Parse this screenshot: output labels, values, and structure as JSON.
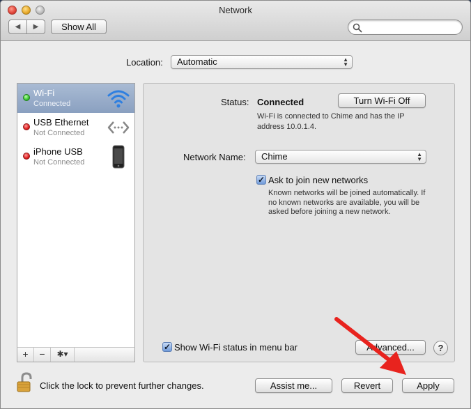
{
  "window": {
    "title": "Network"
  },
  "toolbar": {
    "show_all_label": "Show All",
    "back_glyph": "◀",
    "forward_glyph": "▶"
  },
  "location": {
    "label": "Location:",
    "value": "Automatic"
  },
  "services": [
    {
      "name": "Wi-Fi",
      "status": "Connected",
      "state": "green",
      "icon": "wifi-icon",
      "selected": true
    },
    {
      "name": "USB Ethernet",
      "status": "Not Connected",
      "state": "red",
      "icon": "ethernet-arrows-icon",
      "selected": false
    },
    {
      "name": "iPhone USB",
      "status": "Not Connected",
      "state": "red",
      "icon": "iphone-icon",
      "selected": false
    }
  ],
  "sidebar_footer": {
    "add": "+",
    "remove": "−",
    "gear": "✱▾"
  },
  "detail": {
    "status_label": "Status:",
    "status_value": "Connected",
    "turn_off_label": "Turn Wi-Fi Off",
    "status_desc": "Wi-Fi is connected to Chime and has the IP address 10.0.1.4.",
    "network_name_label": "Network Name:",
    "network_name_value": "Chime",
    "ask_label": "Ask to join new networks",
    "ask_checked": true,
    "ask_desc": "Known networks will be joined automatically. If no known networks are available, you will be asked before joining a new network.",
    "menubar_label": "Show Wi-Fi status in menu bar",
    "menubar_checked": true,
    "advanced_label": "Advanced...",
    "help_label": "?"
  },
  "footer": {
    "lock_label": "Click the lock to prevent further changes.",
    "assist_label": "Assist me...",
    "revert_label": "Revert",
    "apply_label": "Apply"
  },
  "colors": {
    "selection": "#8aa0c0",
    "annotation_arrow": "#e8231e",
    "status_green": "#36c42e",
    "status_red": "#e01e1e"
  }
}
